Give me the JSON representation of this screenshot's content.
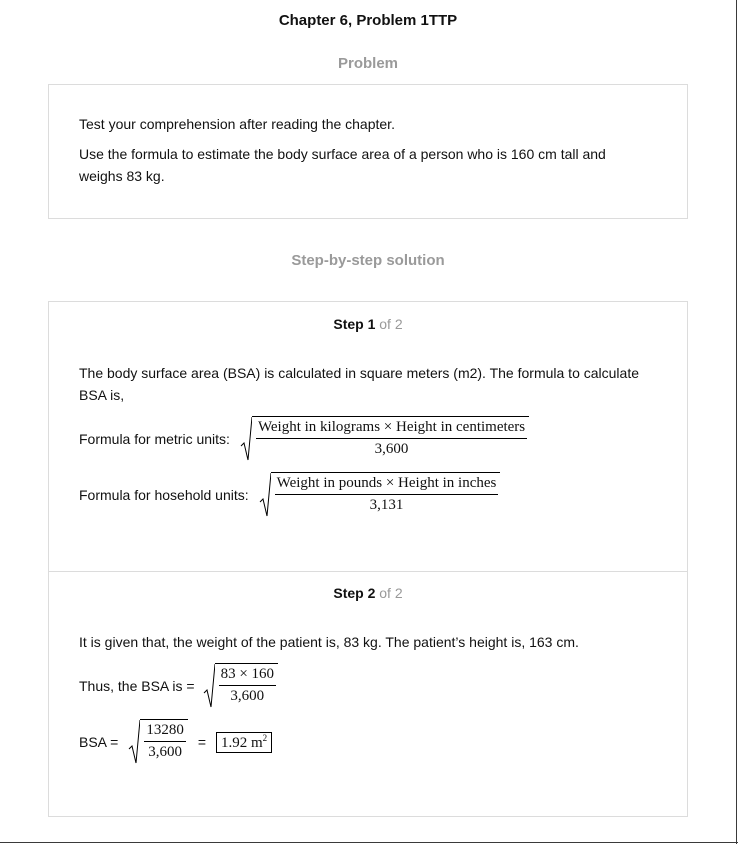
{
  "header": {
    "title": "Chapter 6, Problem 1TTP"
  },
  "problem": {
    "heading": "Problem",
    "line1": "Test your comprehension after reading the chapter.",
    "line2": "Use the formula to estimate the body surface area of a person who is 160 cm tall and weighs 83 kg."
  },
  "solution": {
    "heading": "Step-by-step solution",
    "step1": {
      "label": "Step 1",
      "of": "of 2",
      "text": "The body surface area (BSA) is calculated in square meters (m2). The formula to calculate BSA is,",
      "metric_label": "Formula for metric units:",
      "metric_num": "Weight in kilograms × Height in centimeters",
      "metric_den": "3,600",
      "household_label": "Formula for hosehold units:",
      "household_num": "Weight in pounds × Height in inches",
      "household_den": "3,131"
    },
    "step2": {
      "label": "Step 2",
      "of": "of 2",
      "text": "It is given that, the weight of the patient is, 83 kg. The patient’s height is, 163 cm.",
      "thus_label": "Thus, the BSA is =",
      "thus_num": "83 × 160",
      "thus_den": "3,600",
      "bsa_label": "BSA =",
      "bsa_num": "13280",
      "bsa_den": "3,600",
      "equals": "=",
      "result": "1.92 m",
      "result_exp": "2"
    }
  }
}
